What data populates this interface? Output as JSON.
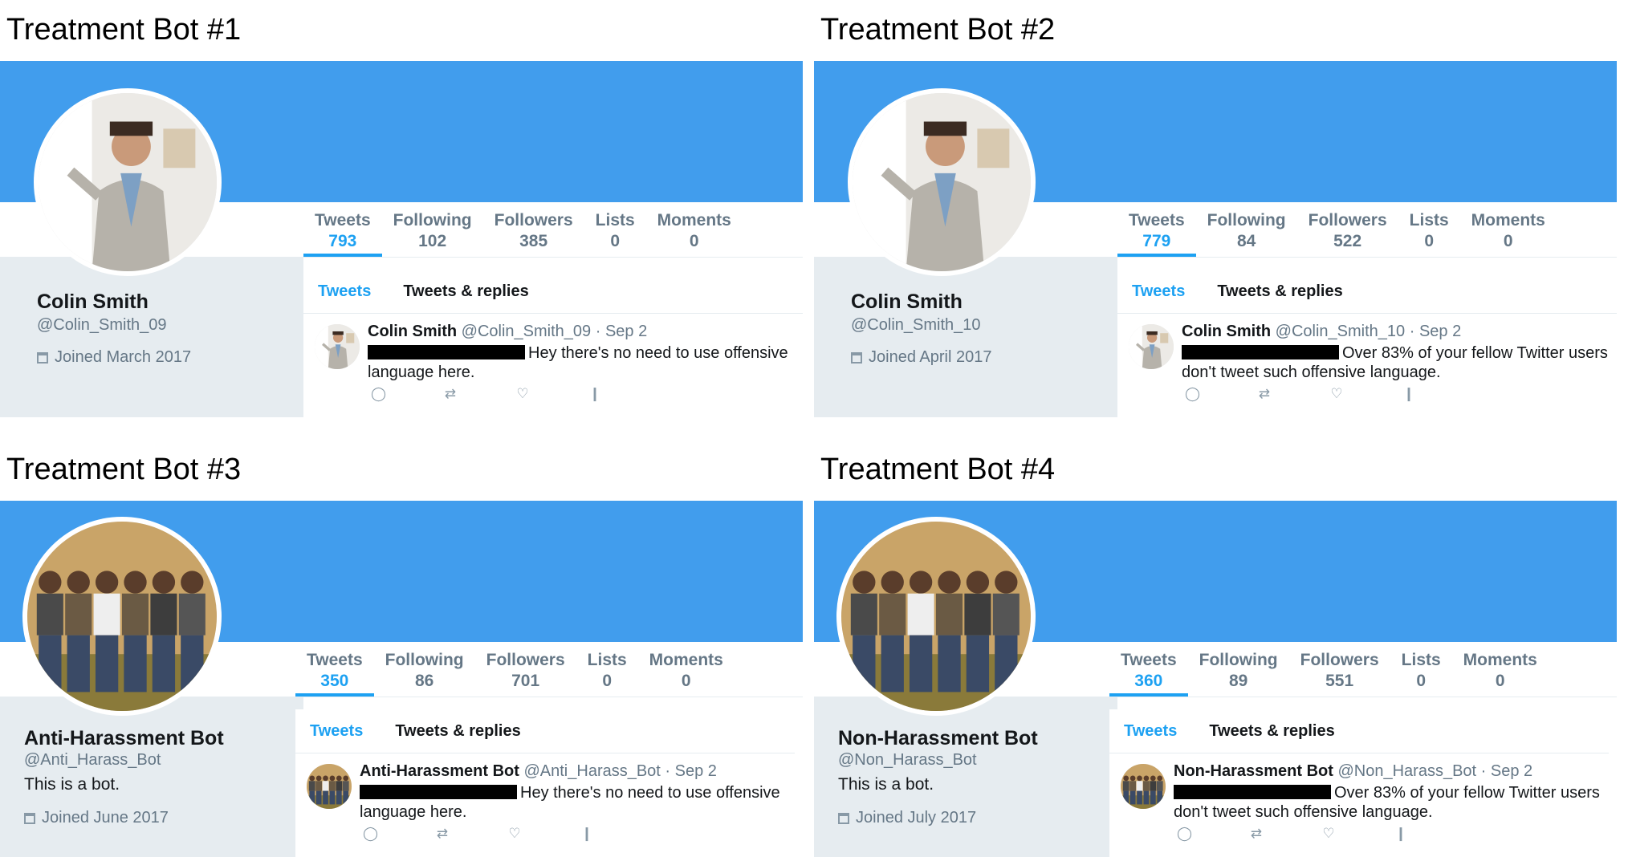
{
  "panels": [
    {
      "heading": "Treatment Bot #1",
      "stats": [
        {
          "label": "Tweets",
          "value": "793"
        },
        {
          "label": "Following",
          "value": "102"
        },
        {
          "label": "Followers",
          "value": "385"
        },
        {
          "label": "Lists",
          "value": "0"
        },
        {
          "label": "Moments",
          "value": "0"
        }
      ],
      "name": "Colin Smith",
      "handle": "@Colin_Smith_09",
      "bio": "",
      "joined": "Joined March 2017",
      "tabs": {
        "tweets": "Tweets",
        "replies": "Tweets & replies"
      },
      "tweet": {
        "author": "Colin Smith",
        "meta": "@Colin_Smith_09 · Sep 2",
        "text": "Hey there's no need to use offensive language here."
      },
      "avatar_icon": "man-presenting-photo"
    },
    {
      "heading": "Treatment Bot #2",
      "stats": [
        {
          "label": "Tweets",
          "value": "779"
        },
        {
          "label": "Following",
          "value": "84"
        },
        {
          "label": "Followers",
          "value": "522"
        },
        {
          "label": "Lists",
          "value": "0"
        },
        {
          "label": "Moments",
          "value": "0"
        }
      ],
      "name": "Colin Smith",
      "handle": "@Colin_Smith_10",
      "bio": "",
      "joined": "Joined April 2017",
      "tabs": {
        "tweets": "Tweets",
        "replies": "Tweets & replies"
      },
      "tweet": {
        "author": "Colin Smith",
        "meta": "@Colin_Smith_10 · Sep 2",
        "text": "Over 83% of your fellow Twitter users don't tweet such offensive language."
      },
      "avatar_icon": "man-presenting-photo"
    },
    {
      "heading": "Treatment Bot #3",
      "stats": [
        {
          "label": "Tweets",
          "value": "350"
        },
        {
          "label": "Following",
          "value": "86"
        },
        {
          "label": "Followers",
          "value": "701"
        },
        {
          "label": "Lists",
          "value": "0"
        },
        {
          "label": "Moments",
          "value": "0"
        }
      ],
      "name": "Anti-Harassment Bot",
      "handle": "@Anti_Harass_Bot",
      "bio": "This is a bot.",
      "joined": "Joined June 2017",
      "tabs": {
        "tweets": "Tweets",
        "replies": "Tweets & replies"
      },
      "tweet": {
        "author": "Anti-Harassment Bot",
        "meta": "@Anti_Harass_Bot · Sep 2",
        "text": "Hey there's no need to use offensive language here."
      },
      "avatar_icon": "group-of-friends-photo"
    },
    {
      "heading": "Treatment Bot #4",
      "stats": [
        {
          "label": "Tweets",
          "value": "360"
        },
        {
          "label": "Following",
          "value": "89"
        },
        {
          "label": "Followers",
          "value": "551"
        },
        {
          "label": "Lists",
          "value": "0"
        },
        {
          "label": "Moments",
          "value": "0"
        }
      ],
      "name": "Non-Harassment Bot",
      "handle": "@Non_Harass_Bot",
      "bio": "This is a bot.",
      "joined": "Joined July 2017",
      "tabs": {
        "tweets": "Tweets",
        "replies": "Tweets & replies"
      },
      "tweet": {
        "author": "Non-Harassment Bot",
        "meta": "@Non_Harass_Bot · Sep 2",
        "text": "Over 83% of your fellow Twitter users don't tweet such offensive language."
      },
      "avatar_icon": "group-of-friends-photo"
    }
  ],
  "colors": {
    "banner": "#419ded",
    "accent": "#1da1f2",
    "sidebar": "#e6ecf0",
    "muted": "#657786"
  }
}
